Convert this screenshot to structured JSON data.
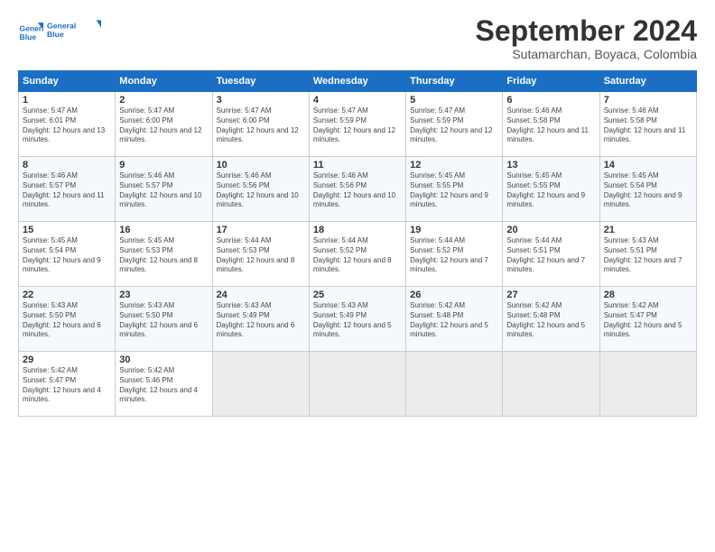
{
  "header": {
    "logo_line1": "General",
    "logo_line2": "Blue",
    "month_title": "September 2024",
    "subtitle": "Sutamarchan, Boyaca, Colombia"
  },
  "days_of_week": [
    "Sunday",
    "Monday",
    "Tuesday",
    "Wednesday",
    "Thursday",
    "Friday",
    "Saturday"
  ],
  "weeks": [
    [
      {
        "day": "1",
        "sunrise": "5:47 AM",
        "sunset": "6:01 PM",
        "daylight": "12 hours and 13 minutes."
      },
      {
        "day": "2",
        "sunrise": "5:47 AM",
        "sunset": "6:00 PM",
        "daylight": "12 hours and 12 minutes."
      },
      {
        "day": "3",
        "sunrise": "5:47 AM",
        "sunset": "6:00 PM",
        "daylight": "12 hours and 12 minutes."
      },
      {
        "day": "4",
        "sunrise": "5:47 AM",
        "sunset": "5:59 PM",
        "daylight": "12 hours and 12 minutes."
      },
      {
        "day": "5",
        "sunrise": "5:47 AM",
        "sunset": "5:59 PM",
        "daylight": "12 hours and 12 minutes."
      },
      {
        "day": "6",
        "sunrise": "5:46 AM",
        "sunset": "5:58 PM",
        "daylight": "12 hours and 11 minutes."
      },
      {
        "day": "7",
        "sunrise": "5:46 AM",
        "sunset": "5:58 PM",
        "daylight": "12 hours and 11 minutes."
      }
    ],
    [
      {
        "day": "8",
        "sunrise": "5:46 AM",
        "sunset": "5:57 PM",
        "daylight": "12 hours and 11 minutes."
      },
      {
        "day": "9",
        "sunrise": "5:46 AM",
        "sunset": "5:57 PM",
        "daylight": "12 hours and 10 minutes."
      },
      {
        "day": "10",
        "sunrise": "5:46 AM",
        "sunset": "5:56 PM",
        "daylight": "12 hours and 10 minutes."
      },
      {
        "day": "11",
        "sunrise": "5:46 AM",
        "sunset": "5:56 PM",
        "daylight": "12 hours and 10 minutes."
      },
      {
        "day": "12",
        "sunrise": "5:45 AM",
        "sunset": "5:55 PM",
        "daylight": "12 hours and 9 minutes."
      },
      {
        "day": "13",
        "sunrise": "5:45 AM",
        "sunset": "5:55 PM",
        "daylight": "12 hours and 9 minutes."
      },
      {
        "day": "14",
        "sunrise": "5:45 AM",
        "sunset": "5:54 PM",
        "daylight": "12 hours and 9 minutes."
      }
    ],
    [
      {
        "day": "15",
        "sunrise": "5:45 AM",
        "sunset": "5:54 PM",
        "daylight": "12 hours and 9 minutes."
      },
      {
        "day": "16",
        "sunrise": "5:45 AM",
        "sunset": "5:53 PM",
        "daylight": "12 hours and 8 minutes."
      },
      {
        "day": "17",
        "sunrise": "5:44 AM",
        "sunset": "5:53 PM",
        "daylight": "12 hours and 8 minutes."
      },
      {
        "day": "18",
        "sunrise": "5:44 AM",
        "sunset": "5:52 PM",
        "daylight": "12 hours and 8 minutes."
      },
      {
        "day": "19",
        "sunrise": "5:44 AM",
        "sunset": "5:52 PM",
        "daylight": "12 hours and 7 minutes."
      },
      {
        "day": "20",
        "sunrise": "5:44 AM",
        "sunset": "5:51 PM",
        "daylight": "12 hours and 7 minutes."
      },
      {
        "day": "21",
        "sunrise": "5:43 AM",
        "sunset": "5:51 PM",
        "daylight": "12 hours and 7 minutes."
      }
    ],
    [
      {
        "day": "22",
        "sunrise": "5:43 AM",
        "sunset": "5:50 PM",
        "daylight": "12 hours and 6 minutes."
      },
      {
        "day": "23",
        "sunrise": "5:43 AM",
        "sunset": "5:50 PM",
        "daylight": "12 hours and 6 minutes."
      },
      {
        "day": "24",
        "sunrise": "5:43 AM",
        "sunset": "5:49 PM",
        "daylight": "12 hours and 6 minutes."
      },
      {
        "day": "25",
        "sunrise": "5:43 AM",
        "sunset": "5:49 PM",
        "daylight": "12 hours and 5 minutes."
      },
      {
        "day": "26",
        "sunrise": "5:42 AM",
        "sunset": "5:48 PM",
        "daylight": "12 hours and 5 minutes."
      },
      {
        "day": "27",
        "sunrise": "5:42 AM",
        "sunset": "5:48 PM",
        "daylight": "12 hours and 5 minutes."
      },
      {
        "day": "28",
        "sunrise": "5:42 AM",
        "sunset": "5:47 PM",
        "daylight": "12 hours and 5 minutes."
      }
    ],
    [
      {
        "day": "29",
        "sunrise": "5:42 AM",
        "sunset": "5:47 PM",
        "daylight": "12 hours and 4 minutes."
      },
      {
        "day": "30",
        "sunrise": "5:42 AM",
        "sunset": "5:46 PM",
        "daylight": "12 hours and 4 minutes."
      },
      null,
      null,
      null,
      null,
      null
    ]
  ]
}
